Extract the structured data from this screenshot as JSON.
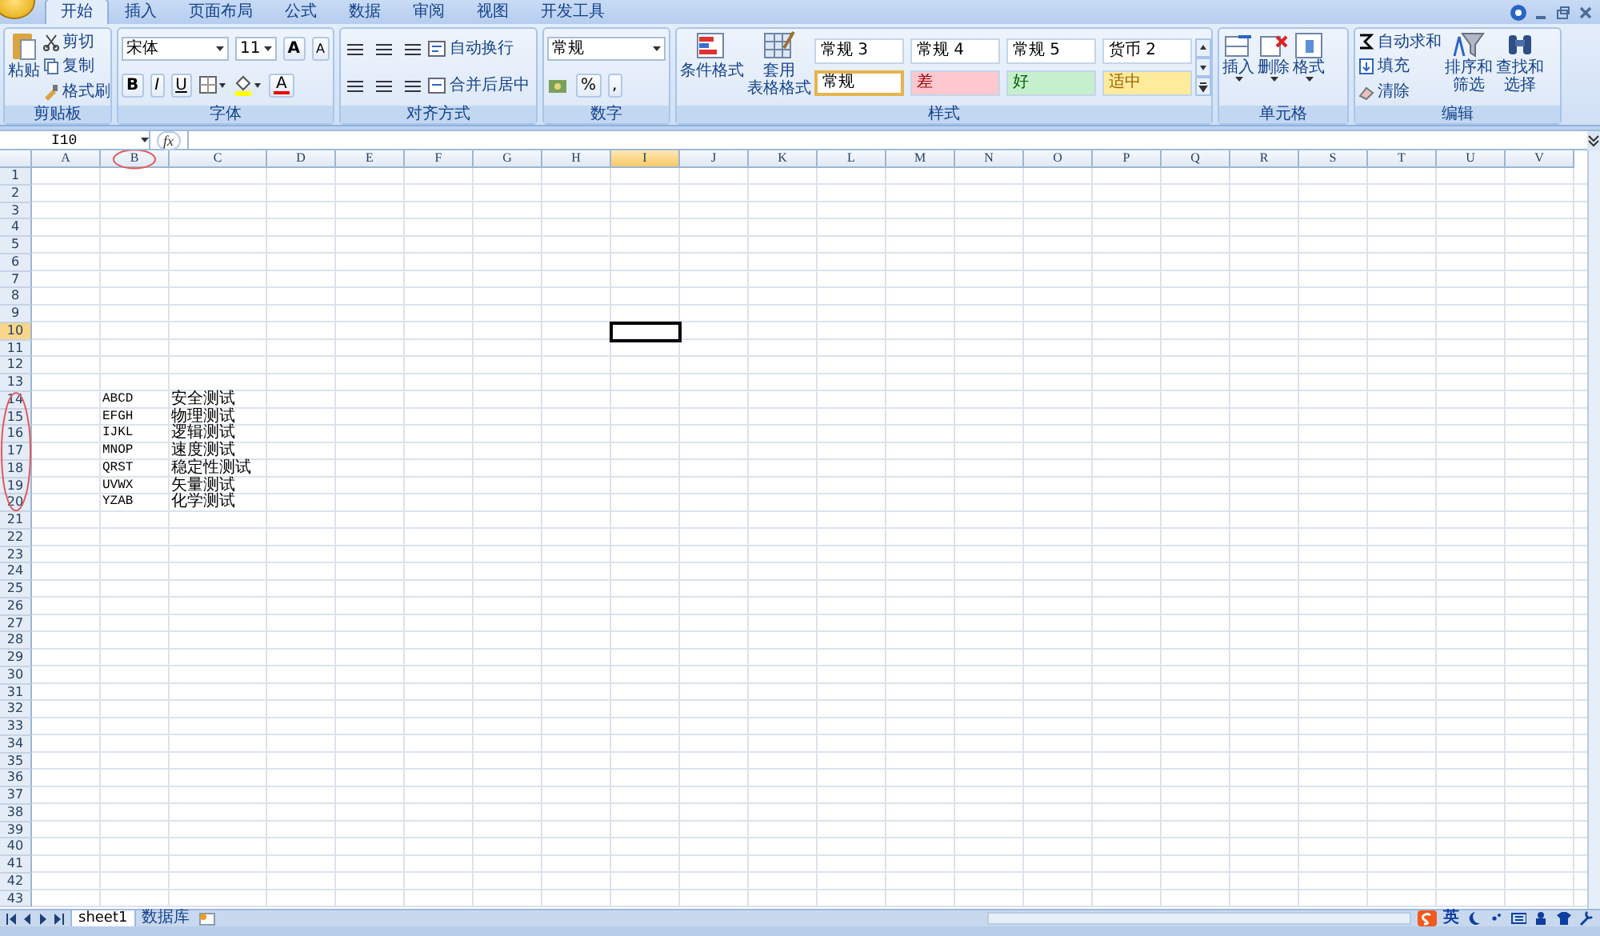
{
  "tabs": [
    {
      "label": "开始",
      "selected": true
    },
    {
      "label": "插入",
      "selected": false
    },
    {
      "label": "页面布局",
      "selected": false
    },
    {
      "label": "公式",
      "selected": false
    },
    {
      "label": "数据",
      "selected": false
    },
    {
      "label": "审阅",
      "selected": false
    },
    {
      "label": "视图",
      "selected": false
    },
    {
      "label": "开发工具",
      "selected": false
    }
  ],
  "ribbon": {
    "clipboard": {
      "label": "剪贴板",
      "paste": "粘贴",
      "items": [
        "剪切",
        "复制",
        "格式刷"
      ]
    },
    "font": {
      "label": "字体",
      "font_name": "宋体",
      "font_size": "11",
      "grow": "A",
      "shrink": "A",
      "bold": "B",
      "italic": "I",
      "underline": "U",
      "font_color": "A"
    },
    "alignment": {
      "label": "对齐方式",
      "wrap": "自动换行",
      "merge": "合并后居中"
    },
    "number": {
      "label": "数字",
      "format": "常规",
      "percent": "%",
      "comma": ","
    },
    "styles": {
      "label": "样式",
      "conditional": "条件格式",
      "table_format": [
        "套用",
        "表格格式"
      ],
      "cells": [
        {
          "text": "常规 3",
          "kind": "plain",
          "selected": false
        },
        {
          "text": "常规 4",
          "kind": "plain",
          "selected": false
        },
        {
          "text": "常规 5",
          "kind": "plain",
          "selected": false
        },
        {
          "text": "货币 2",
          "kind": "plain",
          "selected": false
        },
        {
          "text": "常规",
          "kind": "plain",
          "selected": true
        },
        {
          "text": "差",
          "kind": "bad",
          "selected": false
        },
        {
          "text": "好",
          "kind": "good",
          "selected": false
        },
        {
          "text": "适中",
          "kind": "neutral",
          "selected": false
        }
      ]
    },
    "cells": {
      "label": "单元格",
      "buttons": [
        "插入",
        "删除",
        "格式"
      ]
    },
    "editing": {
      "label": "编辑",
      "items": [
        "自动求和",
        "填充",
        "清除"
      ],
      "sort": [
        "排序和",
        "筛选"
      ],
      "find": [
        "查找和",
        "选择"
      ]
    }
  },
  "formula_bar": {
    "name_box": "I10",
    "fx": "fx"
  },
  "columns": [
    {
      "label": "A",
      "selected": false
    },
    {
      "label": "B",
      "selected": false,
      "circled": true
    },
    {
      "label": "C",
      "selected": false
    },
    {
      "label": "D",
      "selected": false
    },
    {
      "label": "E",
      "selected": false
    },
    {
      "label": "F",
      "selected": false
    },
    {
      "label": "G",
      "selected": false
    },
    {
      "label": "H",
      "selected": false
    },
    {
      "label": "I",
      "selected": true
    },
    {
      "label": "J",
      "selected": false
    },
    {
      "label": "K",
      "selected": false
    },
    {
      "label": "L",
      "selected": false
    },
    {
      "label": "M",
      "selected": false
    },
    {
      "label": "N",
      "selected": false
    },
    {
      "label": "O",
      "selected": false
    },
    {
      "label": "P",
      "selected": false
    },
    {
      "label": "Q",
      "selected": false
    },
    {
      "label": "R",
      "selected": false
    },
    {
      "label": "S",
      "selected": false
    },
    {
      "label": "T",
      "selected": false
    },
    {
      "label": "U",
      "selected": false
    },
    {
      "label": "V",
      "selected": false
    }
  ],
  "rows": [
    {
      "label": "1",
      "selected": false
    },
    {
      "label": "2",
      "selected": false
    },
    {
      "label": "3",
      "selected": false
    },
    {
      "label": "4",
      "selected": false
    },
    {
      "label": "5",
      "selected": false
    },
    {
      "label": "6",
      "selected": false
    },
    {
      "label": "7",
      "selected": false
    },
    {
      "label": "8",
      "selected": false
    },
    {
      "label": "9",
      "selected": false
    },
    {
      "label": "10",
      "selected": true
    },
    {
      "label": "11",
      "selected": false
    },
    {
      "label": "12",
      "selected": false
    },
    {
      "label": "13",
      "selected": false
    },
    {
      "label": "14",
      "selected": false,
      "circled": true,
      "b": "ABCD",
      "c": "安全测试"
    },
    {
      "label": "15",
      "selected": false,
      "circled": true,
      "b": "EFGH",
      "c": "物理测试"
    },
    {
      "label": "16",
      "selected": false,
      "circled": true,
      "b": "IJKL",
      "c": "逻辑测试"
    },
    {
      "label": "17",
      "selected": false,
      "circled": true,
      "b": "MNOP",
      "c": "速度测试"
    },
    {
      "label": "18",
      "selected": false,
      "circled": true,
      "b": "QRST",
      "c": "稳定性测试"
    },
    {
      "label": "19",
      "selected": false,
      "circled": true,
      "b": "UVWX",
      "c": "矢量测试"
    },
    {
      "label": "20",
      "selected": false,
      "circled": true,
      "b": "YZAB",
      "c": "化学测试"
    },
    {
      "label": "21",
      "selected": false
    },
    {
      "label": "22",
      "selected": false
    },
    {
      "label": "23",
      "selected": false
    },
    {
      "label": "24",
      "selected": false
    },
    {
      "label": "25",
      "selected": false
    },
    {
      "label": "26",
      "selected": false
    },
    {
      "label": "27",
      "selected": false
    },
    {
      "label": "28",
      "selected": false
    },
    {
      "label": "29",
      "selected": false
    },
    {
      "label": "30",
      "selected": false
    },
    {
      "label": "31",
      "selected": false
    },
    {
      "label": "32",
      "selected": false
    },
    {
      "label": "33",
      "selected": false
    },
    {
      "label": "34",
      "selected": false
    },
    {
      "label": "35",
      "selected": false
    },
    {
      "label": "36",
      "selected": false
    },
    {
      "label": "37",
      "selected": false
    },
    {
      "label": "38",
      "selected": false
    },
    {
      "label": "39",
      "selected": false
    },
    {
      "label": "40",
      "selected": false
    },
    {
      "label": "41",
      "selected": false
    },
    {
      "label": "42",
      "selected": false
    },
    {
      "label": "43",
      "selected": false
    }
  ],
  "sheets": [
    {
      "label": "sheet1",
      "selected": true
    },
    {
      "label": "数据库",
      "selected": false
    }
  ],
  "ime": {
    "lang": "英"
  }
}
